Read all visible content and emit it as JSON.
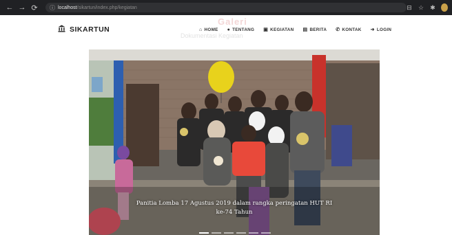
{
  "browser": {
    "url_host": "localhost",
    "url_path": "/sikartun/index.php/kegiatan"
  },
  "navbar": {
    "brand": "SIKARTUN",
    "items": [
      {
        "label": "HOME",
        "icon": "home-icon"
      },
      {
        "label": "TENTANG",
        "icon": "info-icon"
      },
      {
        "label": "KEGIATAN",
        "icon": "calendar-icon"
      },
      {
        "label": "BERITA",
        "icon": "newspaper-icon"
      },
      {
        "label": "KONTAK",
        "icon": "phone-icon"
      },
      {
        "label": "LOGIN",
        "icon": "sign-in-icon"
      }
    ]
  },
  "page": {
    "title": "Galeri",
    "subtitle": "Dokumentasi Kegiatan"
  },
  "carousel": {
    "caption_line1": "Panitia Lomba 17 Agustus 2019 dalam rangka peringatan HUT RI",
    "caption_line2": "ke-74 Tahun",
    "slide_count": 6,
    "active_slide": 1
  },
  "colors": {
    "chrome": "#202124",
    "shirt_red": "#e8493a",
    "balloon": "#e8d21c",
    "pillar_red": "#c8322b",
    "pillar_blue": "#2d5fb0"
  }
}
